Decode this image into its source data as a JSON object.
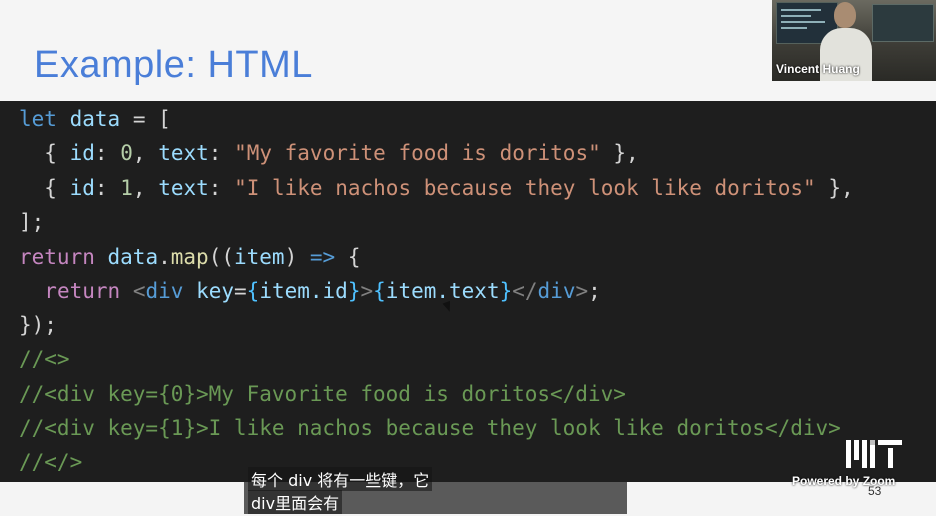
{
  "slide": {
    "title": "Example: HTML",
    "page_number": "53"
  },
  "video": {
    "participant_name": "Vincent Huang"
  },
  "code": {
    "l1": [
      "let",
      "data",
      "= ["
    ],
    "l2": [
      "{",
      "id",
      ":",
      "0",
      ",",
      "text",
      ":",
      "\"My favorite food is doritos\"",
      "},"
    ],
    "l3": [
      "{",
      "id",
      ":",
      "1",
      ",",
      "text",
      ":",
      "\"I like nachos because they look like doritos\"",
      "},"
    ],
    "l4": "];",
    "l5": [
      "return",
      "data",
      ".",
      "map",
      "((",
      "item",
      ")",
      "=>",
      "{"
    ],
    "l6": [
      "return",
      "<",
      "div",
      "key",
      "=",
      "{",
      "item.id",
      "}",
      ">",
      "{",
      "item.text",
      "}",
      "</",
      "div",
      ">",
      ";"
    ],
    "l7": "});",
    "c1": "//<>",
    "c2": "//<div key={0}>My Favorite food is doritos</div>",
    "c3": "//<div key={1}>I like nachos because they look like doritos</div>",
    "c4": "//</>"
  },
  "subtitles": {
    "line1": "每个 div 将有一些键，它",
    "line2": "div里面会有"
  },
  "zoom": {
    "powered_by": "Powered by Zoom"
  }
}
